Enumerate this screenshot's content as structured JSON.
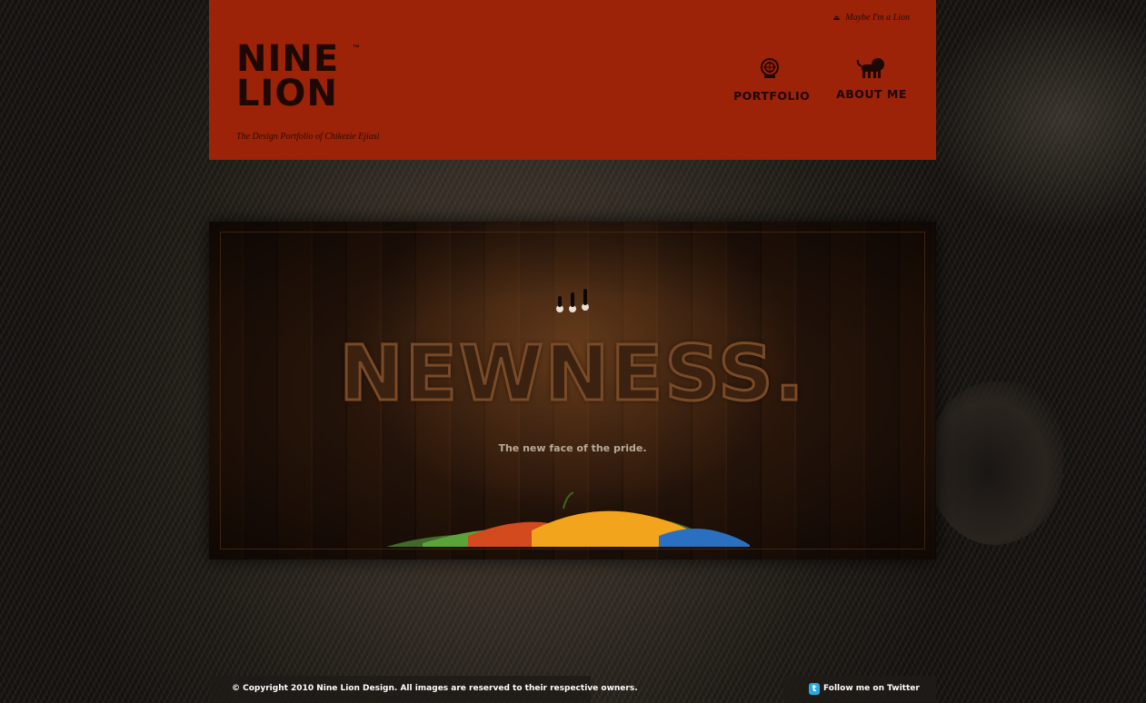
{
  "header": {
    "top_link": "Maybe I'm a Lion",
    "logo_line1": "NINE",
    "logo_line2": "LION",
    "logo_tm": "™",
    "tagline": "The Design Portfolio of Chikezie Ejiasi",
    "nav": [
      {
        "label": "PORTFOLIO",
        "icon": "portfolio-seal-icon"
      },
      {
        "label": "ABOUT ME",
        "icon": "lion-icon"
      }
    ]
  },
  "banner": {
    "headline": "NEWNESS.",
    "subline": "The new face of the pride."
  },
  "footer": {
    "copyright": "© Copyright 2010 Nine Lion Design. All images are reserved to their respective owners.",
    "twitter_label": "Follow me on Twitter",
    "twitter_icon": "twitter-bird-icon"
  },
  "colors": {
    "header_bg": "#9c2208",
    "header_text": "#1e0803",
    "twitter_blue": "#2aa9e0"
  }
}
